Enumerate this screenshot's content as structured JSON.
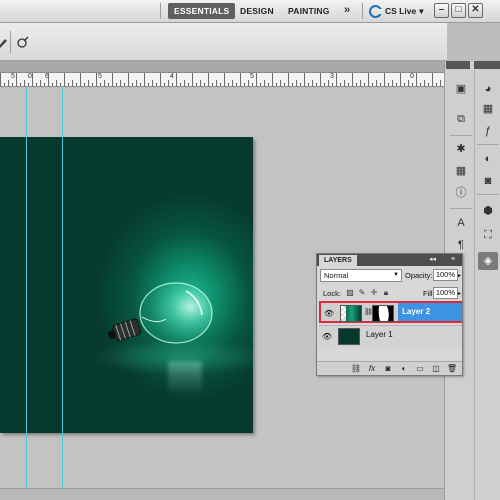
{
  "appbar": {
    "workspaces": [
      "ESSENTIALS",
      "DESIGN",
      "PAINTING"
    ],
    "active_workspace": "ESSENTIALS",
    "more_label": "»",
    "cs_live_label": "CS Live",
    "cs_live_caret": "▾",
    "window_buttons": [
      "–",
      "□",
      "✕"
    ]
  },
  "options_bar": {
    "tool_icons": [
      "brush-tool-icon",
      "airbrush-icon"
    ]
  },
  "ruler": {
    "labels": [
      "5",
      "0",
      "5",
      "6",
      "4",
      "5",
      "3",
      "0",
      "0"
    ]
  },
  "layers_panel": {
    "tab_label": "LAYERS",
    "collapse_label": "◂◂",
    "menu_label": "≡",
    "blend_mode": "Normal",
    "opacity_label": "Opacity:",
    "opacity_value": "100%",
    "lock_label": "Lock:",
    "fill_label": "Fill:",
    "fill_value": "100%",
    "layers": [
      {
        "name": "Layer 2",
        "selected": true,
        "visible": true,
        "has_mask": true
      },
      {
        "name": "Layer 1",
        "selected": false,
        "visible": true,
        "has_mask": false
      }
    ],
    "footer_icons": [
      "link-icon",
      "fx-icon",
      "mask-icon",
      "adjustment-icon",
      "folder-icon",
      "new-layer-icon",
      "trash-icon"
    ]
  },
  "colors": {
    "accent_selection": "#3c93e3",
    "highlight_border": "#e0283a",
    "canvas_green": "#063a2c",
    "guide_cyan": "#4ec9d8"
  }
}
